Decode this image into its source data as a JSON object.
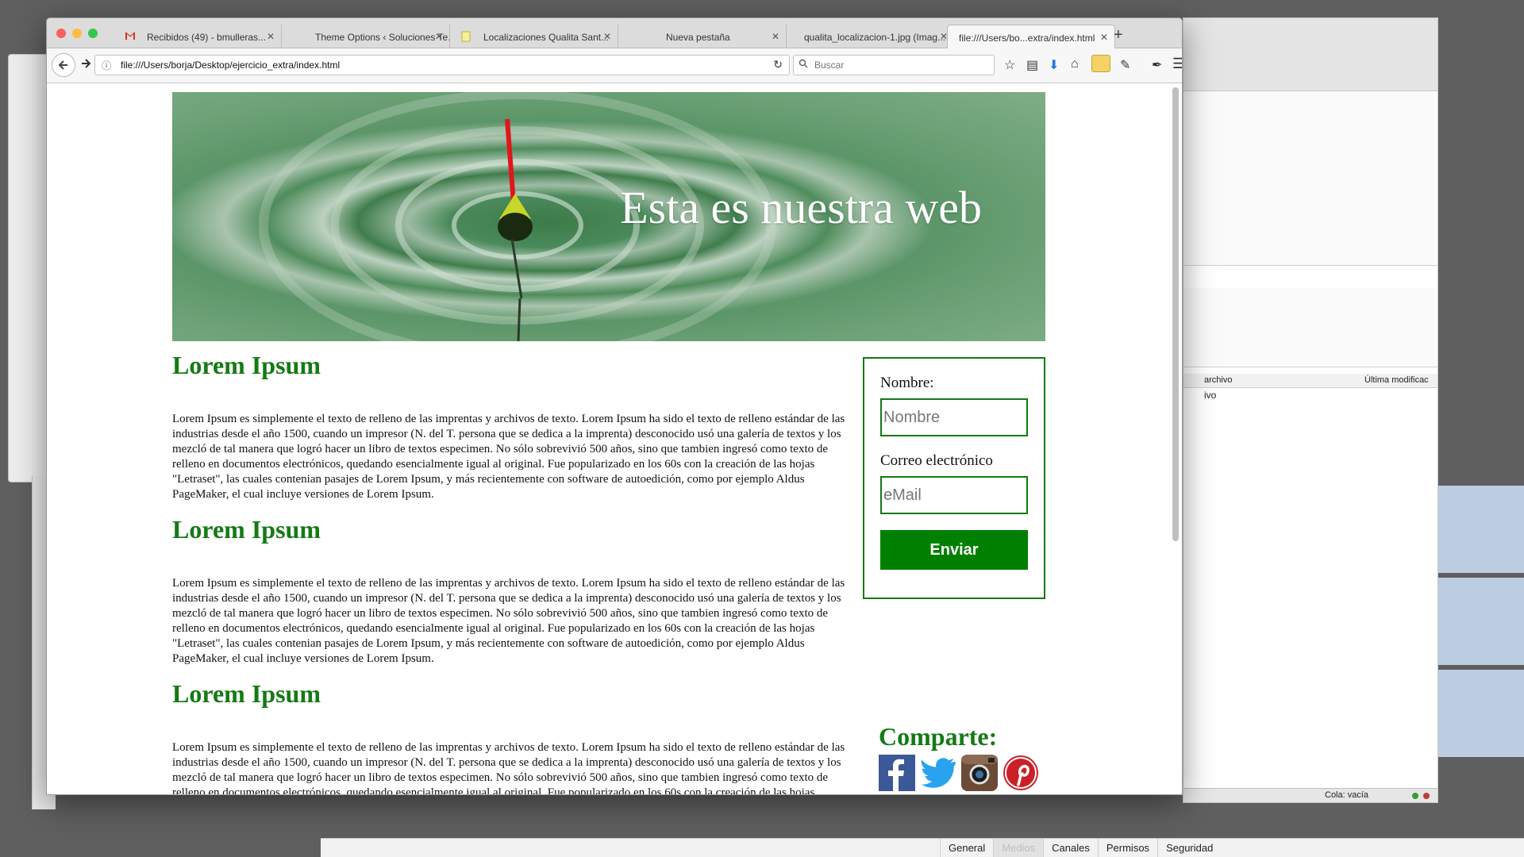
{
  "browser": {
    "tabs": [
      {
        "label": "Recibidos (49) - bmulleras...",
        "icon": "gmail-icon"
      },
      {
        "label": "Theme Options ‹ Soluciones Te...",
        "icon": "blank-page-icon"
      },
      {
        "label": "Localizaciones Qualita Sant...",
        "icon": "document-icon"
      },
      {
        "label": "Nueva pestaña",
        "icon": "none"
      },
      {
        "label": "qualita_localizacion-1.jpg (Imag...",
        "icon": "none"
      },
      {
        "label": "file:///Users/bo...extra/index.html",
        "icon": "none"
      }
    ],
    "url": "file:///Users/borja/Desktop/ejercicio_extra/index.html",
    "search_placeholder": "Buscar",
    "new_tab_label": "+"
  },
  "page": {
    "hero_title": "Esta es nuestra web",
    "sections": [
      {
        "title": "Lorem Ipsum",
        "text": "Lorem Ipsum es simplemente el texto de relleno de las imprentas y archivos de texto. Lorem Ipsum ha sido el texto de relleno estándar de las industrias desde el año 1500, cuando un impresor (N. del T. persona que se dedica a la imprenta) desconocido usó una galería de textos y los mezcló de tal manera que logró hacer un libro de textos especimen. No sólo sobrevivió 500 años, sino que tambien ingresó como texto de relleno en documentos electrónicos, quedando esencialmente igual al original. Fue popularizado en los 60s con la creación de las hojas \"Letraset\", las cuales contenian pasajes de Lorem Ipsum, y más recientemente con software de autoedición, como por ejemplo Aldus PageMaker, el cual incluye versiones de Lorem Ipsum."
      },
      {
        "title": "Lorem Ipsum",
        "text": "Lorem Ipsum es simplemente el texto de relleno de las imprentas y archivos de texto. Lorem Ipsum ha sido el texto de relleno estándar de las industrias desde el año 1500, cuando un impresor (N. del T. persona que se dedica a la imprenta) desconocido usó una galería de textos y los mezcló de tal manera que logró hacer un libro de textos especimen. No sólo sobrevivió 500 años, sino que tambien ingresó como texto de relleno en documentos electrónicos, quedando esencialmente igual al original. Fue popularizado en los 60s con la creación de las hojas \"Letraset\", las cuales contenian pasajes de Lorem Ipsum, y más recientemente con software de autoedición, como por ejemplo Aldus PageMaker, el cual incluye versiones de Lorem Ipsum."
      },
      {
        "title": "Lorem Ipsum",
        "text": "Lorem Ipsum es simplemente el texto de relleno de las imprentas y archivos de texto. Lorem Ipsum ha sido el texto de relleno estándar de las industrias desde el año 1500, cuando un impresor (N. del T. persona que se dedica a la imprenta) desconocido usó una galería de textos y los mezcló de tal manera que logró hacer un libro de textos especimen. No sólo sobrevivió 500 años, sino que tambien ingresó como texto de relleno en documentos electrónicos, quedando esencialmente igual al original. Fue popularizado en los 60s con la creación de las hojas \"Letraset\", las cuales contenian pasajes de Lorem Ipsum, y más recientemente con software de autoedición, como por ejemplo Aldus PageMaker, el cual incluye versiones de Lorem Ipsum."
      }
    ],
    "form": {
      "name_label": "Nombre:",
      "name_placeholder": "Nombre",
      "email_label": "Correo electrónico",
      "email_placeholder": "eMail",
      "submit_label": "Enviar"
    },
    "share": {
      "title": "Comparte:",
      "networks": [
        "facebook-icon",
        "twitter-icon",
        "instagram-icon",
        "pinterest-icon"
      ]
    }
  },
  "background_window": {
    "column_headers": [
      "archivo",
      "Última modificac"
    ],
    "status_text": "Cola: vacía",
    "partial_text": "ivo"
  },
  "bottom_tabs": [
    "General",
    "Medios",
    "Canales",
    "Permisos",
    "Seguridad"
  ],
  "colors": {
    "accent_green": "#157a15",
    "button_green": "#008000",
    "traffic_close": "#fc605c",
    "traffic_min": "#fdbc40",
    "traffic_max": "#34c84a"
  }
}
